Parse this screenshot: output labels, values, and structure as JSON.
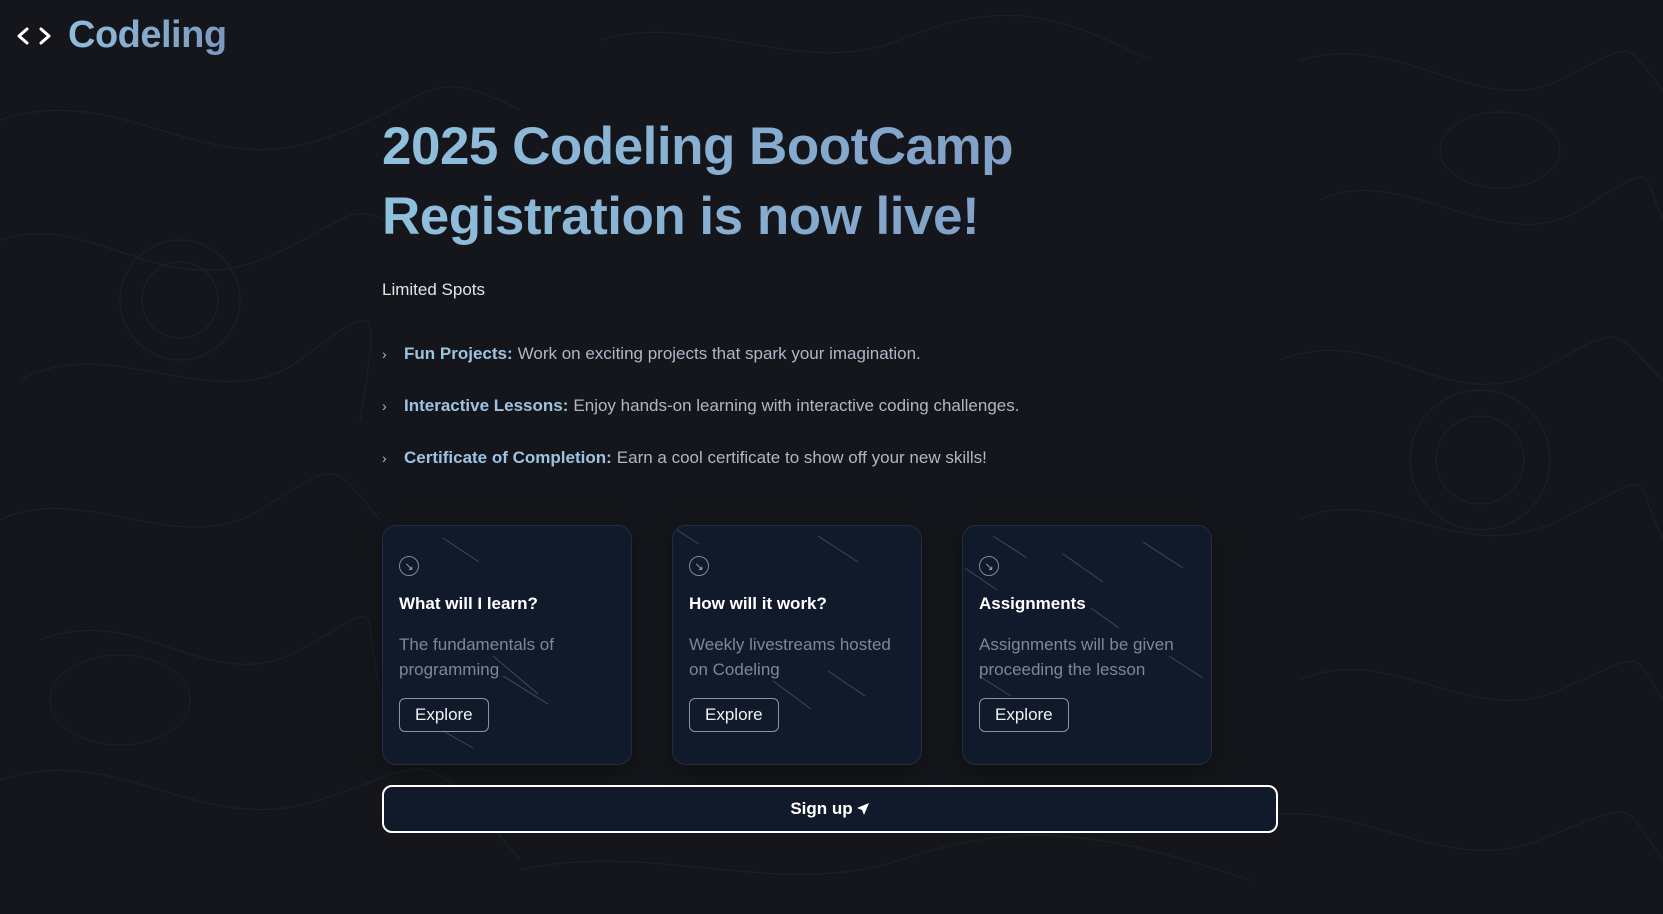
{
  "header": {
    "logo_text": "Codeling",
    "logo_icon": "code-brackets-icon"
  },
  "hero": {
    "title_line1": "2025 Codeling BootCamp",
    "title_line2": "Registration is now live!",
    "subtitle": "Limited Spots"
  },
  "features": [
    {
      "label": "Fun Projects:",
      "text": "Work on exciting projects that spark your imagination."
    },
    {
      "label": "Interactive Lessons:",
      "text": "Enjoy hands-on learning with interactive coding challenges."
    },
    {
      "label": "Certificate of Completion:",
      "text": "Earn a cool certificate to show off your new skills!"
    }
  ],
  "cards": [
    {
      "icon": "arrow-down-right-icon",
      "title": "What will I learn?",
      "description": "The fundamentals of programming",
      "button": "Explore"
    },
    {
      "icon": "arrow-down-right-icon",
      "title": "How will it work?",
      "description": "Weekly livestreams hosted on Codeling",
      "button": "Explore"
    },
    {
      "icon": "arrow-down-right-icon",
      "title": "Assignments",
      "description": "Assignments will be given proceeding the lesson",
      "button": "Explore"
    }
  ],
  "signup": {
    "label": "Sign up",
    "icon": "send-arrow-icon"
  },
  "colors": {
    "background": "#14161b",
    "card": "#111a2b",
    "accent": "#8fbcd8",
    "feature_label": "#9cc4e2"
  }
}
